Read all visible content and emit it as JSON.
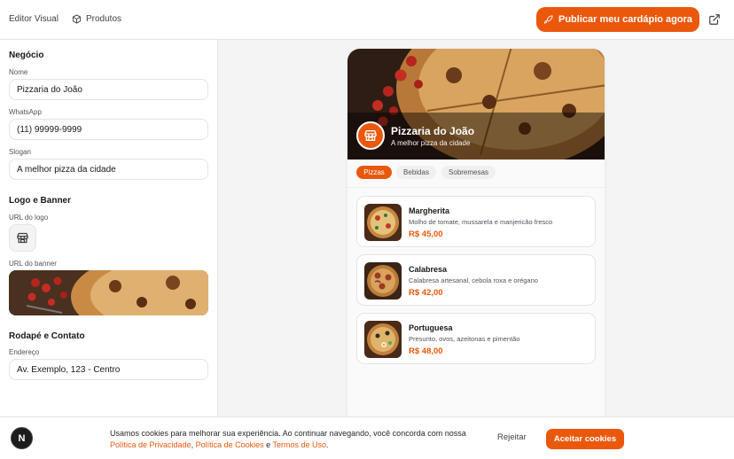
{
  "topbar": {
    "tabs": [
      "Editor Visual",
      "Produtos"
    ],
    "publish_label": "Publicar meu cardápio agora",
    "icons": {
      "produtos": "box-icon",
      "publish": "rocket-icon",
      "external": "external-link-icon"
    }
  },
  "sidebar": {
    "business": {
      "title": "Negócio",
      "name_label": "Nome",
      "name_value": "Pizzaria do João",
      "whatsapp_label": "WhatsApp",
      "whatsapp_value": "(11) 99999-9999",
      "slogan_label": "Slogan",
      "slogan_value": "A melhor pizza da cidade"
    },
    "logo_banner": {
      "title": "Logo e Banner",
      "logo_label": "URL do logo",
      "banner_label": "URL do banner"
    },
    "footer": {
      "title": "Rodapé e Contato",
      "address_label": "Endereço",
      "address_value": "Av. Exemplo, 123 - Centro"
    }
  },
  "preview": {
    "name": "Pizzaria do João",
    "slogan": "A melhor pizza da cidade",
    "categories": [
      "Pizzas",
      "Bebidas",
      "Sobremesas"
    ],
    "active_category": "Pizzas",
    "products": [
      {
        "name": "Margherita",
        "description": "Molho de tomate, mussarela e manjericão fresco",
        "price": "R$ 45,00"
      },
      {
        "name": "Calabresa",
        "description": "Calabresa artesanal, cebola roxa e orégano",
        "price": "R$ 42,00"
      },
      {
        "name": "Portuguesa",
        "description": "Presunto, ovos, azeitonas e pimentão",
        "price": "R$ 48,00"
      }
    ]
  },
  "cookie": {
    "text_1": "Usamos cookies para melhorar sua experiência. Ao continuar navegando, você concorda com nossa ",
    "privacy_link": "Política de Privacidade",
    "sep_1": ", ",
    "cookies_link": "Política de Cookies",
    "sep_2": " e ",
    "terms_link": "Termos de Uso",
    "end": ".",
    "reject_label": "Rejeitar",
    "accept_label": "Aceitar cookies",
    "badge": "N"
  },
  "colors": {
    "accent": "#ea580c",
    "border": "#e4e4e7",
    "background": "#f4f4f5"
  }
}
